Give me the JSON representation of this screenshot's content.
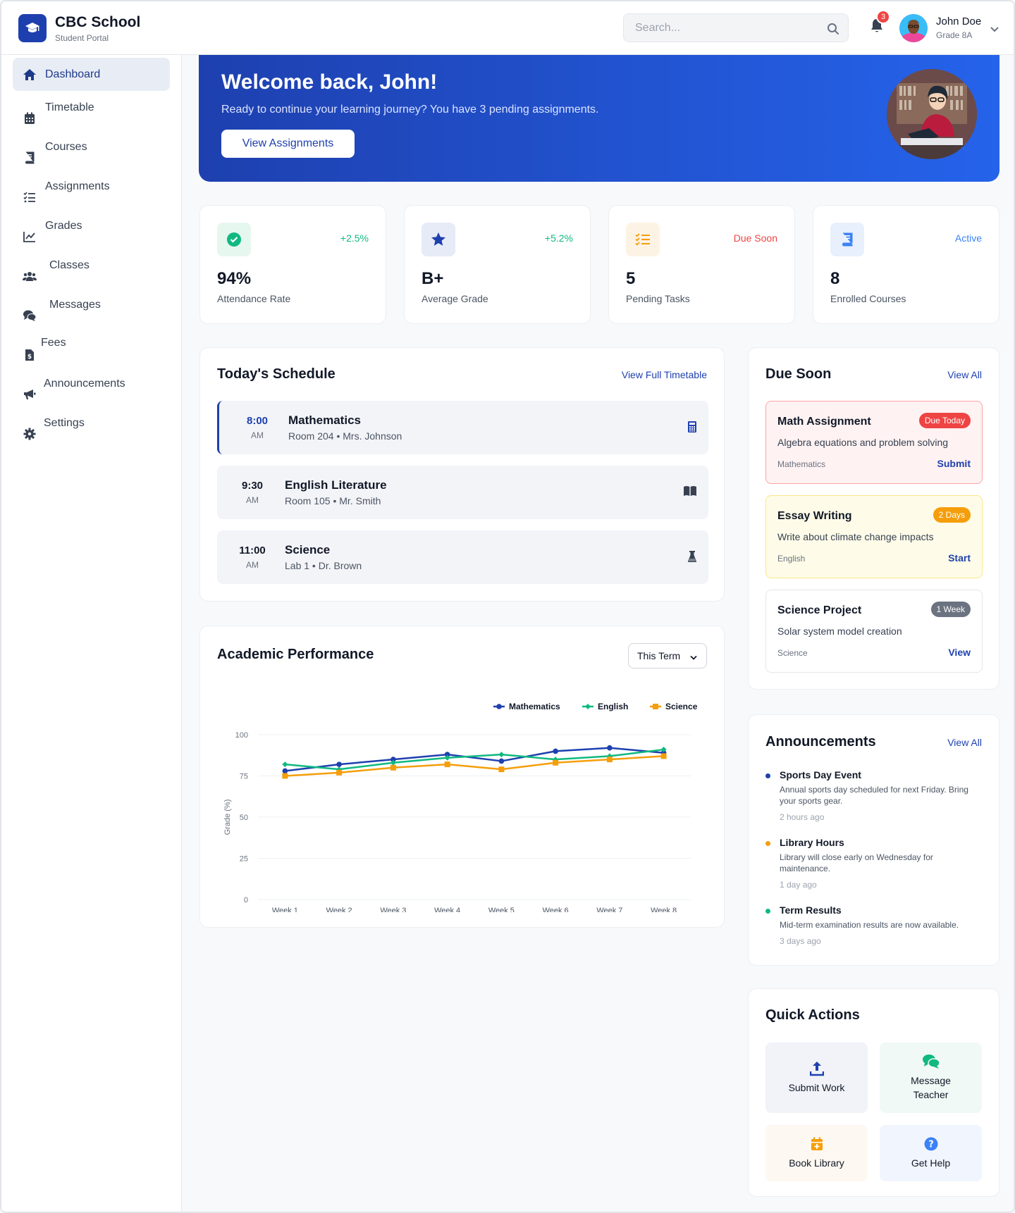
{
  "brand": {
    "name": "CBC School",
    "subtitle": "Student Portal"
  },
  "search": {
    "placeholder": "Search..."
  },
  "notifications": {
    "count": "3"
  },
  "user": {
    "name": "John Doe",
    "grade": "Grade 8A"
  },
  "sidebar": {
    "items": [
      {
        "label": "Dashboard",
        "icon": "home-icon",
        "active": true
      },
      {
        "label": "Timetable",
        "icon": "calendar-icon"
      },
      {
        "label": "Courses",
        "icon": "book-icon"
      },
      {
        "label": "Assignments",
        "icon": "tasks-icon"
      },
      {
        "label": "Grades",
        "icon": "chart-line-icon"
      },
      {
        "label": "Classes",
        "icon": "users-icon"
      },
      {
        "label": "Messages",
        "icon": "comments-icon"
      },
      {
        "label": "Fees",
        "icon": "invoice-icon"
      },
      {
        "label": "Announcements",
        "icon": "megaphone-icon"
      },
      {
        "label": "Settings",
        "icon": "gear-icon"
      }
    ]
  },
  "hero": {
    "title": "Welcome back, John!",
    "subtitle": "Ready to continue your learning journey? You have 3 pending assignments.",
    "button": "View Assignments"
  },
  "stats": [
    {
      "value": "94%",
      "label": "Attendance Rate",
      "tag": "+2.5%",
      "tag_color": "#10b981",
      "icon": "check-circle-icon"
    },
    {
      "value": "B+",
      "label": "Average Grade",
      "tag": "+5.2%",
      "tag_color": "#10b981",
      "icon": "star-icon"
    },
    {
      "value": "5",
      "label": "Pending Tasks",
      "tag": "Due Soon",
      "tag_color": "#ef4444",
      "icon": "list-check-icon"
    },
    {
      "value": "8",
      "label": "Enrolled Courses",
      "tag": "Active",
      "tag_color": "#3b82f6",
      "icon": "book-icon"
    }
  ],
  "schedule": {
    "title": "Today's Schedule",
    "link": "View Full Timetable",
    "items": [
      {
        "time": "8:00",
        "ampm": "AM",
        "subject": "Mathematics",
        "room": "Room 204 • Mrs. Johnson",
        "icon": "calculator-icon"
      },
      {
        "time": "9:30",
        "ampm": "AM",
        "subject": "English Literature",
        "room": "Room 105 • Mr. Smith",
        "icon": "open-book-icon"
      },
      {
        "time": "11:00",
        "ampm": "AM",
        "subject": "Science",
        "room": "Lab 1 • Dr. Brown",
        "icon": "flask-icon"
      }
    ]
  },
  "performance": {
    "title": "Academic Performance",
    "selector": "This Term"
  },
  "chart_data": {
    "type": "line",
    "ylabel": "Grade (%)",
    "xlabel": "",
    "ylim": [
      0,
      100
    ],
    "yticks": [
      "0",
      "25",
      "50",
      "75",
      "100"
    ],
    "grid": true,
    "legend": "top-right",
    "categories": [
      "Week 1",
      "Week 2",
      "Week 3",
      "Week 4",
      "Week 5",
      "Week 6",
      "Week 7",
      "Week 8"
    ],
    "series": [
      {
        "name": "Mathematics",
        "color": "#1e40af",
        "marker": "circle",
        "values": [
          78,
          82,
          85,
          88,
          84,
          90,
          92,
          89
        ]
      },
      {
        "name": "English",
        "color": "#10b981",
        "marker": "diamond",
        "values": [
          82,
          79,
          83,
          86,
          88,
          85,
          87,
          91
        ]
      },
      {
        "name": "Science",
        "color": "#f59e0b",
        "marker": "square",
        "values": [
          75,
          77,
          80,
          82,
          79,
          83,
          85,
          87
        ]
      }
    ]
  },
  "due_soon": {
    "title": "Due Soon",
    "link": "View All",
    "items": [
      {
        "title": "Math Assignment",
        "badge": "Due Today",
        "badge_color": "#ef4444",
        "desc": "Algebra equations and problem solving",
        "subject": "Mathematics",
        "action": "Submit"
      },
      {
        "title": "Essay Writing",
        "badge": "2 Days",
        "badge_color": "#f59e0b",
        "desc": "Write about climate change impacts",
        "subject": "English",
        "action": "Start"
      },
      {
        "title": "Science Project",
        "badge": "1 Week",
        "badge_color": "#6b7280",
        "desc": "Solar system model creation",
        "subject": "Science",
        "action": "View"
      }
    ]
  },
  "announcements": {
    "title": "Announcements",
    "link": "View All",
    "items": [
      {
        "title": "Sports Day Event",
        "body": "Annual sports day scheduled for next Friday. Bring your sports gear.",
        "time": "2 hours ago",
        "color": "#1e40af"
      },
      {
        "title": "Library Hours",
        "body": "Library will close early on Wednesday for maintenance.",
        "time": "1 day ago",
        "color": "#f59e0b"
      },
      {
        "title": "Term Results",
        "body": "Mid-term examination results are now available.",
        "time": "3 days ago",
        "color": "#10b981"
      }
    ]
  },
  "quick_actions": {
    "title": "Quick Actions",
    "items": [
      {
        "label": "Submit Work",
        "icon": "upload-icon",
        "color": "#1e40af",
        "bg": "#f1f3f8"
      },
      {
        "label": "Message Teacher",
        "icon": "comments-icon",
        "color": "#10b981",
        "bg": "#f0f9f5"
      },
      {
        "label": "Book Library",
        "icon": "calendar-plus-icon",
        "color": "#f59e0b",
        "bg": "#fdf8f1"
      },
      {
        "label": "Get Help",
        "icon": "question-circle-icon",
        "color": "#3b82f6",
        "bg": "#f1f5fd"
      }
    ]
  }
}
